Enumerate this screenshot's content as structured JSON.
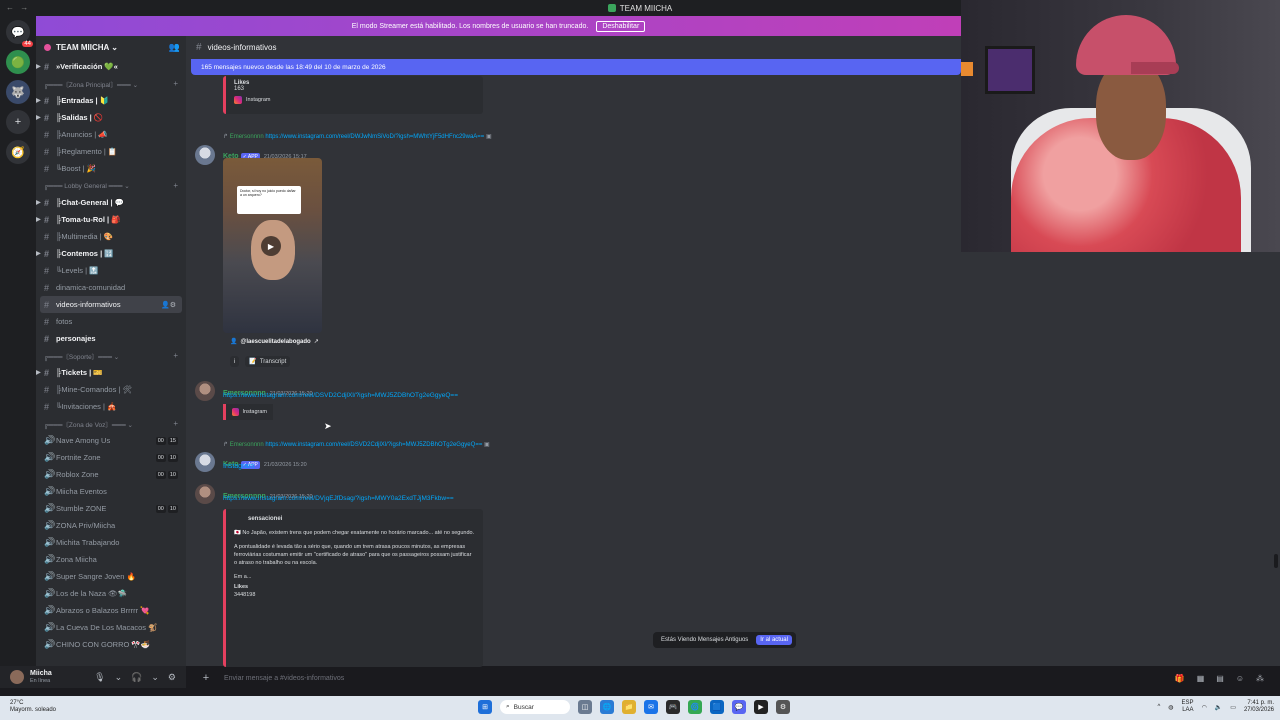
{
  "window": {
    "title": "TEAM MIICHA",
    "nav": "← →"
  },
  "banner": {
    "text": "El modo Streamer está habilitado. Los nombres de usuario se han truncado.",
    "button": "Deshabilitar"
  },
  "rail": {
    "items": [
      "💬",
      "🟢",
      "🐺",
      "+",
      "🧭"
    ],
    "badge": "44"
  },
  "guild": {
    "name": "TEAM MIICHA ⌄",
    "add_icon": "👥"
  },
  "sidebar": {
    "items": [
      {
        "kind": "ch",
        "label": "»Verificación 💚«",
        "bold": true,
        "arrow": true
      },
      {
        "kind": "cat",
        "label": "╔═══〘Zona Principal〙═══ ⌄"
      },
      {
        "kind": "ch",
        "label": "╠Entradas | 🔰",
        "bold": true,
        "arrow": true
      },
      {
        "kind": "ch",
        "label": "╠Salidas | 🚫",
        "bold": true,
        "arrow": true
      },
      {
        "kind": "ch",
        "label": "╠Anuncios | 📣"
      },
      {
        "kind": "ch",
        "label": "╠Reglamento | 📋"
      },
      {
        "kind": "ch",
        "label": "╚Boost | 🎉"
      },
      {
        "kind": "cat",
        "label": "╔═══ Lobby General ═══ ⌄"
      },
      {
        "kind": "ch",
        "label": "╠Chat-General | 💬",
        "bold": true,
        "arrow": true
      },
      {
        "kind": "ch",
        "label": "╠Toma-tu-Rol | 🎒",
        "bold": true,
        "arrow": true
      },
      {
        "kind": "ch",
        "label": "╠Multimedia | 🎨"
      },
      {
        "kind": "ch",
        "label": "╠Contemos | 🔢",
        "bold": true,
        "arrow": true
      },
      {
        "kind": "ch",
        "label": "╚Levels | 🔝"
      },
      {
        "kind": "ch",
        "label": "dinamica-comunidad"
      },
      {
        "kind": "ch",
        "label": "videos-informativos",
        "active": true
      },
      {
        "kind": "ch",
        "label": "fotos"
      },
      {
        "kind": "ch",
        "label": "personajes",
        "bold": true
      },
      {
        "kind": "cat",
        "label": "╔═══〘Soporte〙═══ ⌄"
      },
      {
        "kind": "ch",
        "label": "╠Tickets | 🎫",
        "bold": true,
        "arrow": true
      },
      {
        "kind": "ch",
        "label": "╠Mine-Comandos | 🛠"
      },
      {
        "kind": "ch",
        "label": "╚Invitaciones | 🎪"
      },
      {
        "kind": "cat",
        "label": "╔═══〘Zona de Voz〙═══ ⌄"
      },
      {
        "kind": "vc",
        "label": "Nave Among Us",
        "counts": [
          "00",
          "15"
        ]
      },
      {
        "kind": "vc",
        "label": "Fortnite Zone",
        "counts": [
          "00",
          "10"
        ]
      },
      {
        "kind": "vc",
        "label": "Roblox Zone",
        "counts": [
          "00",
          "10"
        ]
      },
      {
        "kind": "vc",
        "label": "Miicha Eventos"
      },
      {
        "kind": "vc",
        "label": "Stumble ZONE",
        "counts": [
          "00",
          "10"
        ]
      },
      {
        "kind": "vc",
        "label": "ZONA Priv/Miicha"
      },
      {
        "kind": "vc",
        "label": "Michita Trabajando"
      },
      {
        "kind": "vc",
        "label": "Zona Miicha"
      },
      {
        "kind": "vc",
        "label": "Super Sangre Joven 🔥"
      },
      {
        "kind": "vc",
        "label": "Los de la Naza 👁🛸"
      },
      {
        "kind": "vc",
        "label": "Abrazos o Balazos Brrrrr 💘"
      },
      {
        "kind": "vc",
        "label": "La Cueva De Los Macacos 🐒"
      },
      {
        "kind": "vc",
        "label": "CHINO CON GORRO 🎌🍜"
      }
    ]
  },
  "user": {
    "name": "Miicha",
    "status": "En línea",
    "icons": [
      "🎙",
      "⌄",
      "🎧",
      "⌄",
      "⚙"
    ]
  },
  "chat": {
    "channel": "videos-informativos",
    "new_messages": "165 mensajes nuevos desde las 18:49 del 10 de marzo de 2026",
    "top_embed": {
      "likes_label": "Likes",
      "likes": "163",
      "source": "Instagram"
    },
    "msg1": {
      "reply_name": "Emersonnnn",
      "reply_link": "https://www.instagram.com/reel/DWJwNmSiVoD/?igsh=MWhtYjF5dHFnc29waA==",
      "user": "Keto",
      "tag": "✓ APP",
      "time": "21/03/2026 15:17",
      "video_card": "Doctor, si hoy no juicio puedo dañar a un arquero?",
      "author": "@laescuelitadelabogado",
      "info": "i",
      "transcript": "Transcript"
    },
    "msg2": {
      "user": "Emersonnnn",
      "time": "21/03/2026 15:20",
      "link": "https://www.instagram.com/reel/DSVD2CdjlXl/?igsh=MWJ5ZDBhOTg2eGgyeQ==",
      "source": "Instagram"
    },
    "msg3": {
      "reply_name": "Emersonnnn",
      "reply_link": "https://www.instagram.com/reel/DSVD2CdjlXl/?igsh=MWJ5ZDBhOTg2eGgyeQ==",
      "user": "Keto",
      "tag": "✓ APP",
      "time": "21/03/2026 15:20",
      "text": "Instagram"
    },
    "msg4": {
      "user": "Emersonnnn",
      "time": "21/03/2026 15:20",
      "link": "https://www.instagram.com/reel/DVjqEJfDsag/?igsh=MWY0a2ExdTJjM3Fkbw==",
      "embed_author": "sensacionei",
      "p1": "🇯🇵 No Japão, existem trens que podem chegar exatamente no horário marcado... até no segundo.",
      "p2": "A pontualidade é levada tão a sério que, quando um trem atrasa poucos minutos, as empresas ferroviárias costumam emitir um \"certificado de atraso\" para que os passageiros possam justificar o atraso no trabalho ou na escola.",
      "more": "Em a...",
      "likes_label": "Likes",
      "likes": "3448198"
    },
    "old_messages": "Estás Viendo Mensajes Antiguos",
    "jump": "Ir al actual",
    "composer_placeholder": "Enviar mensaje a #videos-informativos",
    "composer_icons": [
      "🎁",
      "▦",
      "▤",
      "☺",
      "⁂"
    ]
  },
  "taskbar": {
    "weather_temp": "27°C",
    "weather_desc": "Mayorm. soleado",
    "search": "Buscar",
    "lang1": "ESP",
    "lang2": "LAA",
    "time": "7:41 p. m.",
    "date": "27/03/2026",
    "apps": [
      "⊞",
      "◫",
      "🌐",
      "📁",
      "✉",
      "🎮",
      "🌀",
      "🟦",
      "💬",
      "▶",
      "⚙"
    ]
  },
  "colors": {
    "accent": "#5865f2",
    "green_name": "#3ba55d",
    "link": "#00a8fc"
  }
}
